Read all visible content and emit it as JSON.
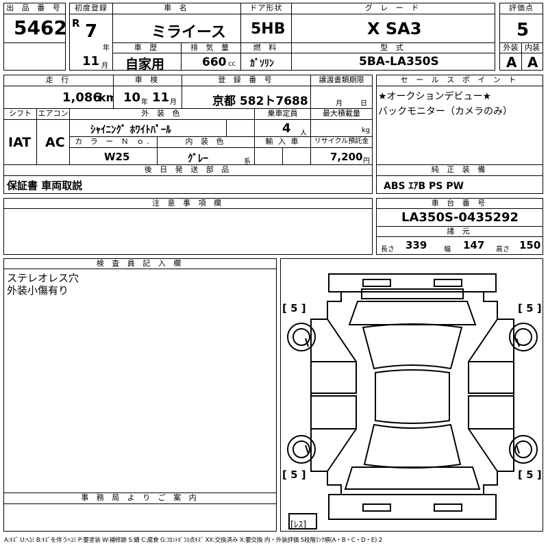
{
  "headers": {
    "lot_no": "出 品 番 号",
    "first_reg": "初度登録",
    "car_name": "車 名",
    "door": "ドア形状",
    "grade": "グ レ ー ド",
    "score": "評価点",
    "history": "車 歴",
    "displacement": "排 気 量",
    "fuel": "燃 料",
    "model": "型 式",
    "exterior": "外装",
    "interior": "内装",
    "mileage": "走 行",
    "inspection": "車 検",
    "reg_no": "登 録 番 号",
    "transfer": "譲渡書類期限",
    "sales_point": "セ ー ル ス ポ イ ン ト",
    "shift": "シフト",
    "aircon": "エアコン",
    "ext_color": "外 装 色",
    "capacity": "乗車定員",
    "max_load": "最大積載量",
    "color_no": "カ ラ ー Ｎ ｏ.",
    "int_color": "内 装 色",
    "import": "輸 入 車",
    "recycle": "リサイクル預託金",
    "later_parts": "後 日 発 送 部 品",
    "genuine": "純 正 装 備",
    "notes": "注 意 事 項 欄",
    "chassis": "車 台 番 号",
    "spec": "諸 元",
    "inspector": "検 査 員 記 入 欄",
    "office": "事 務 局 よ り ご 案 内"
  },
  "values": {
    "lot_no": "5462",
    "era": "R",
    "year": "7",
    "year_unit": "年",
    "month": "11",
    "month_unit": "月",
    "car_name": "ミライース",
    "door": "5HB",
    "grade": "X SA3",
    "score": "5",
    "history": "自家用",
    "displacement": "660",
    "disp_unit": "cc",
    "fuel": "ｶﾞｿﾘﾝ",
    "model": "5BA-LA350S",
    "exterior": "A",
    "interior": "A",
    "mileage": "1,086",
    "mileage_unit": "km",
    "insp_year": "10",
    "insp_year_unit": "年",
    "insp_month": "11",
    "insp_month_unit": "月",
    "reg_no": "京都 582ト7688",
    "transfer_month": "月",
    "transfer_day": "日",
    "sales_point_1": "★オークションデビュー★",
    "sales_point_2": "バックモニター（カメラのみ）",
    "shift": "IAT",
    "aircon": "AC",
    "ext_color": "ｼｬｲﾆﾝｸﾞ ﾎﾜｲﾄﾊﾟｰﾙ",
    "capacity": "4",
    "capacity_unit": "人",
    "max_load_unit": "kg",
    "color_no": "W25",
    "int_color": "ｸﾞﾚｰ",
    "int_color_unit": "系",
    "recycle": "7,200",
    "recycle_unit": "円",
    "later_parts": "保証書 車両取説",
    "genuine": "ABS ｴｱB PS PW",
    "chassis": "LA350S-0435292",
    "length_label": "長さ",
    "length": "339",
    "width_label": "幅",
    "width": "147",
    "height_label": "高さ",
    "height": "150",
    "inspector_1": "ステレオレス穴",
    "inspector_2": "外装小傷有り",
    "tire_fl": "[ 5 ]",
    "tire_fr": "[ 5 ]",
    "tire_rl": "[ 5 ]",
    "tire_rr": "[ 5 ]",
    "spare": "[ﾚｽ]",
    "legend": "A:ｷｽﾞ U:ﾍｺﾐ B:ｷｽﾞを伴うﾍｺﾐ P:要塗装 W:補修跡 S:錆 C:腐食 G:ﾌﾛﾝﾄｶﾞﾗｽ点ｷｽﾞ XX:交換済み X:要交換 内・外装評価 5段階ﾗﾝｸ順(A・B・C・D・E) 2"
  }
}
